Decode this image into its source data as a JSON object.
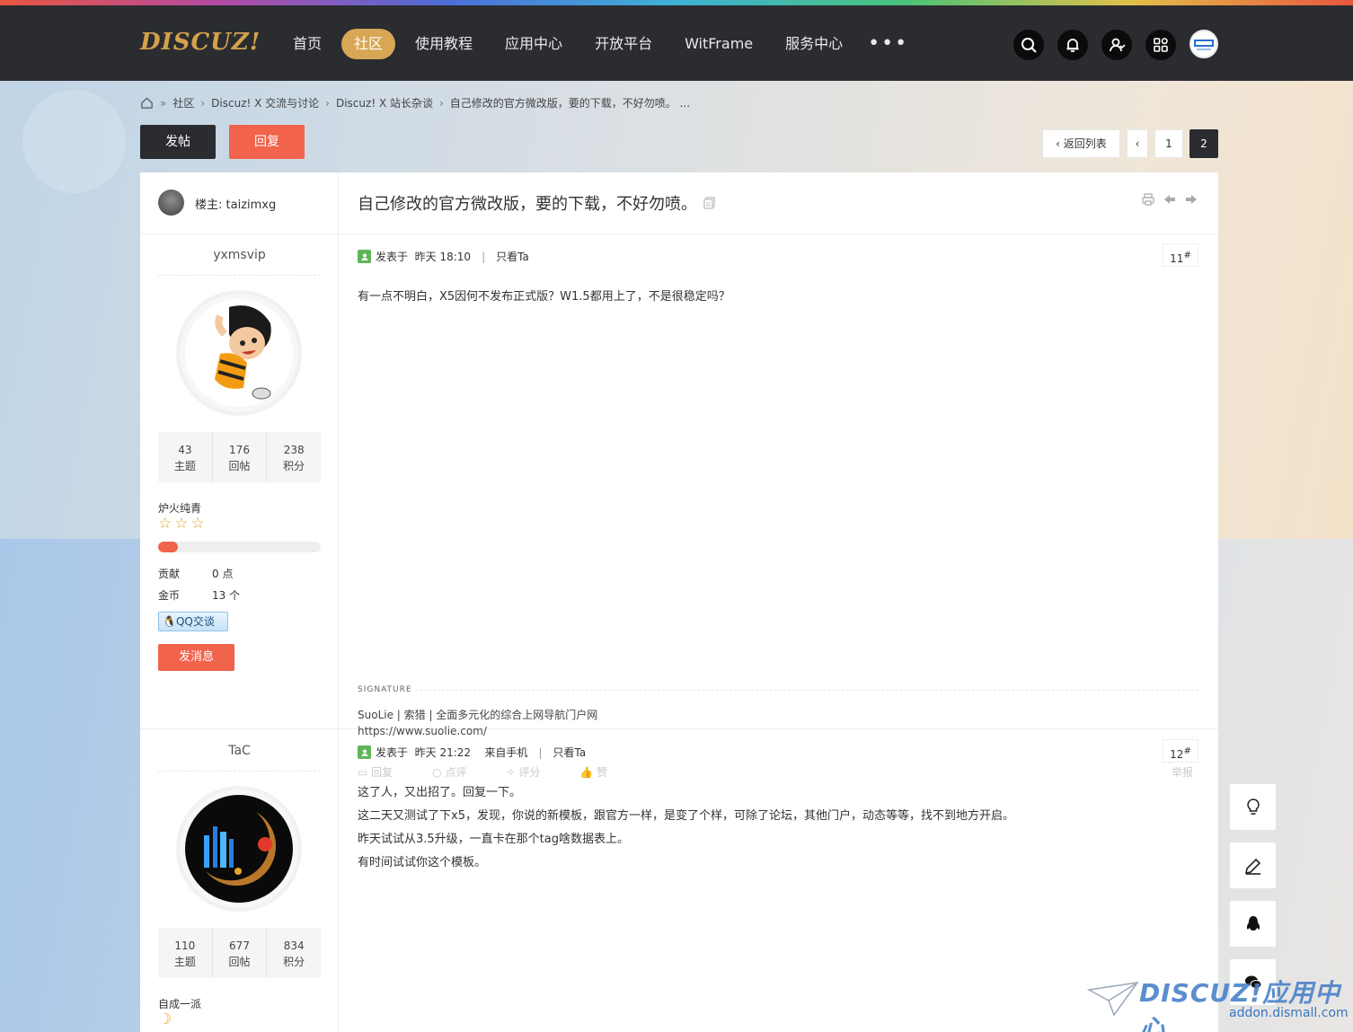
{
  "brand": {
    "logo_text": "DISCUZ!"
  },
  "nav": {
    "items": [
      {
        "label": "首页",
        "active": false
      },
      {
        "label": "社区",
        "active": true
      },
      {
        "label": "使用教程",
        "active": false
      },
      {
        "label": "应用中心",
        "active": false
      },
      {
        "label": "开放平台",
        "active": false
      },
      {
        "label": "WitFrame",
        "active": false
      },
      {
        "label": "服务中心",
        "active": false
      }
    ],
    "more": "•••",
    "icons": [
      "search-icon",
      "bell-icon",
      "user-icon",
      "apps-icon"
    ]
  },
  "breadcrumb": {
    "sep": "»",
    "items": [
      "社区",
      "Discuz! X 交流与讨论",
      "Discuz! X 站长杂谈",
      "自己修改的官方微改版，要的下载，不好勿喷。 ..."
    ]
  },
  "actions": {
    "post_label": "发帖",
    "reply_label": "回复"
  },
  "pager": {
    "back_label": "返回列表",
    "pages": [
      "1",
      "2"
    ],
    "current": "2"
  },
  "thread": {
    "op_label": "楼主: taizimxg",
    "title": "自己修改的官方微改版，要的下载，不好勿喷。"
  },
  "posts": [
    {
      "user": {
        "name": "yxmsvip",
        "stats": [
          {
            "value": "43",
            "label": "主题"
          },
          {
            "value": "176",
            "label": "回帖"
          },
          {
            "value": "238",
            "label": "积分"
          }
        ],
        "group": "炉火纯青",
        "stars": 3,
        "level_progress": 0.12,
        "contribution_label": "贡献",
        "contribution_value": "0 点",
        "coins_label": "金币",
        "coins_value": "13 个",
        "qq_label": "QQ交谈",
        "message_label": "发消息"
      },
      "meta": {
        "posted": "发表于",
        "time": "昨天 18:10",
        "only_label": "只看Ta"
      },
      "floor": "11",
      "content": [
        "有一点不明白，X5因何不发布正式版？W1.5都用上了，不是很稳定吗？"
      ],
      "signature": {
        "label": "SIGNATURE",
        "line1": "SuoLie | 索猎 | 全面多元化的综合上网导航门户网",
        "line2": "https://www.suolie.com/"
      },
      "footer_actions": [
        "回复",
        "点评",
        "评分",
        "赞"
      ],
      "report_label": "举报"
    },
    {
      "user": {
        "name": "TaC",
        "stats": [
          {
            "value": "110",
            "label": "主题"
          },
          {
            "value": "677",
            "label": "回帖"
          },
          {
            "value": "834",
            "label": "积分"
          }
        ],
        "group": "自成一派"
      },
      "meta": {
        "posted": "发表于",
        "time": "昨天 21:22",
        "source": "来自手机",
        "only_label": "只看Ta"
      },
      "floor": "12",
      "content": [
        "这了人，又出招了。回复一下。",
        "这二天又测试了下x5，发现，你说的新模板，跟官方一样，是变了个样，可除了论坛，其他门户，动态等等，找不到地方开启。",
        "昨天试试从3.5升级，一直卡在那个tag啥数据表上。",
        "有时间试试你这个模板。"
      ]
    }
  ],
  "float_tools": [
    "bulb-icon",
    "edit-icon",
    "qq-penguin-icon",
    "wechat-icon"
  ],
  "watermark": {
    "logo": "DISCUZ!应用中心",
    "url": "addon.dismall.com"
  },
  "colors": {
    "nav_bg": "#2b2c30",
    "accent_gold": "#d7a753",
    "accent_red": "#f2634c"
  }
}
